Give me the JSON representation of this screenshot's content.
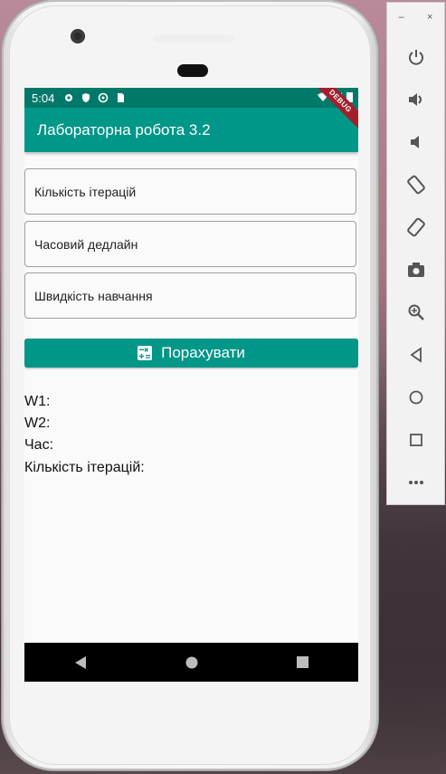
{
  "status_bar": {
    "time": "5:04"
  },
  "app_bar": {
    "title": "Лабораторна робота 3.2",
    "debug_banner": "DEBUG"
  },
  "form": {
    "iterations_placeholder": "Кількість ітерацій",
    "deadline_placeholder": "Часовий дедлайн",
    "learning_rate_placeholder": "Швидкість навчання",
    "calculate_label": "Порахувати"
  },
  "results": {
    "w1": "W1:",
    "w2": "W2:",
    "time": "Час:",
    "iterations": "Кількість ітерацій:"
  },
  "emulator": {
    "minimize": "–",
    "close": "×",
    "icons": [
      "power-icon",
      "volume-up-icon",
      "volume-down-icon",
      "rotate-left-icon",
      "rotate-right-icon",
      "screenshot-icon",
      "zoom-icon",
      "back-icon",
      "home-icon",
      "overview-icon",
      "more-icon"
    ]
  },
  "colors": {
    "status": "#00796b",
    "primary": "#009688",
    "debug": "#a31f2c"
  }
}
